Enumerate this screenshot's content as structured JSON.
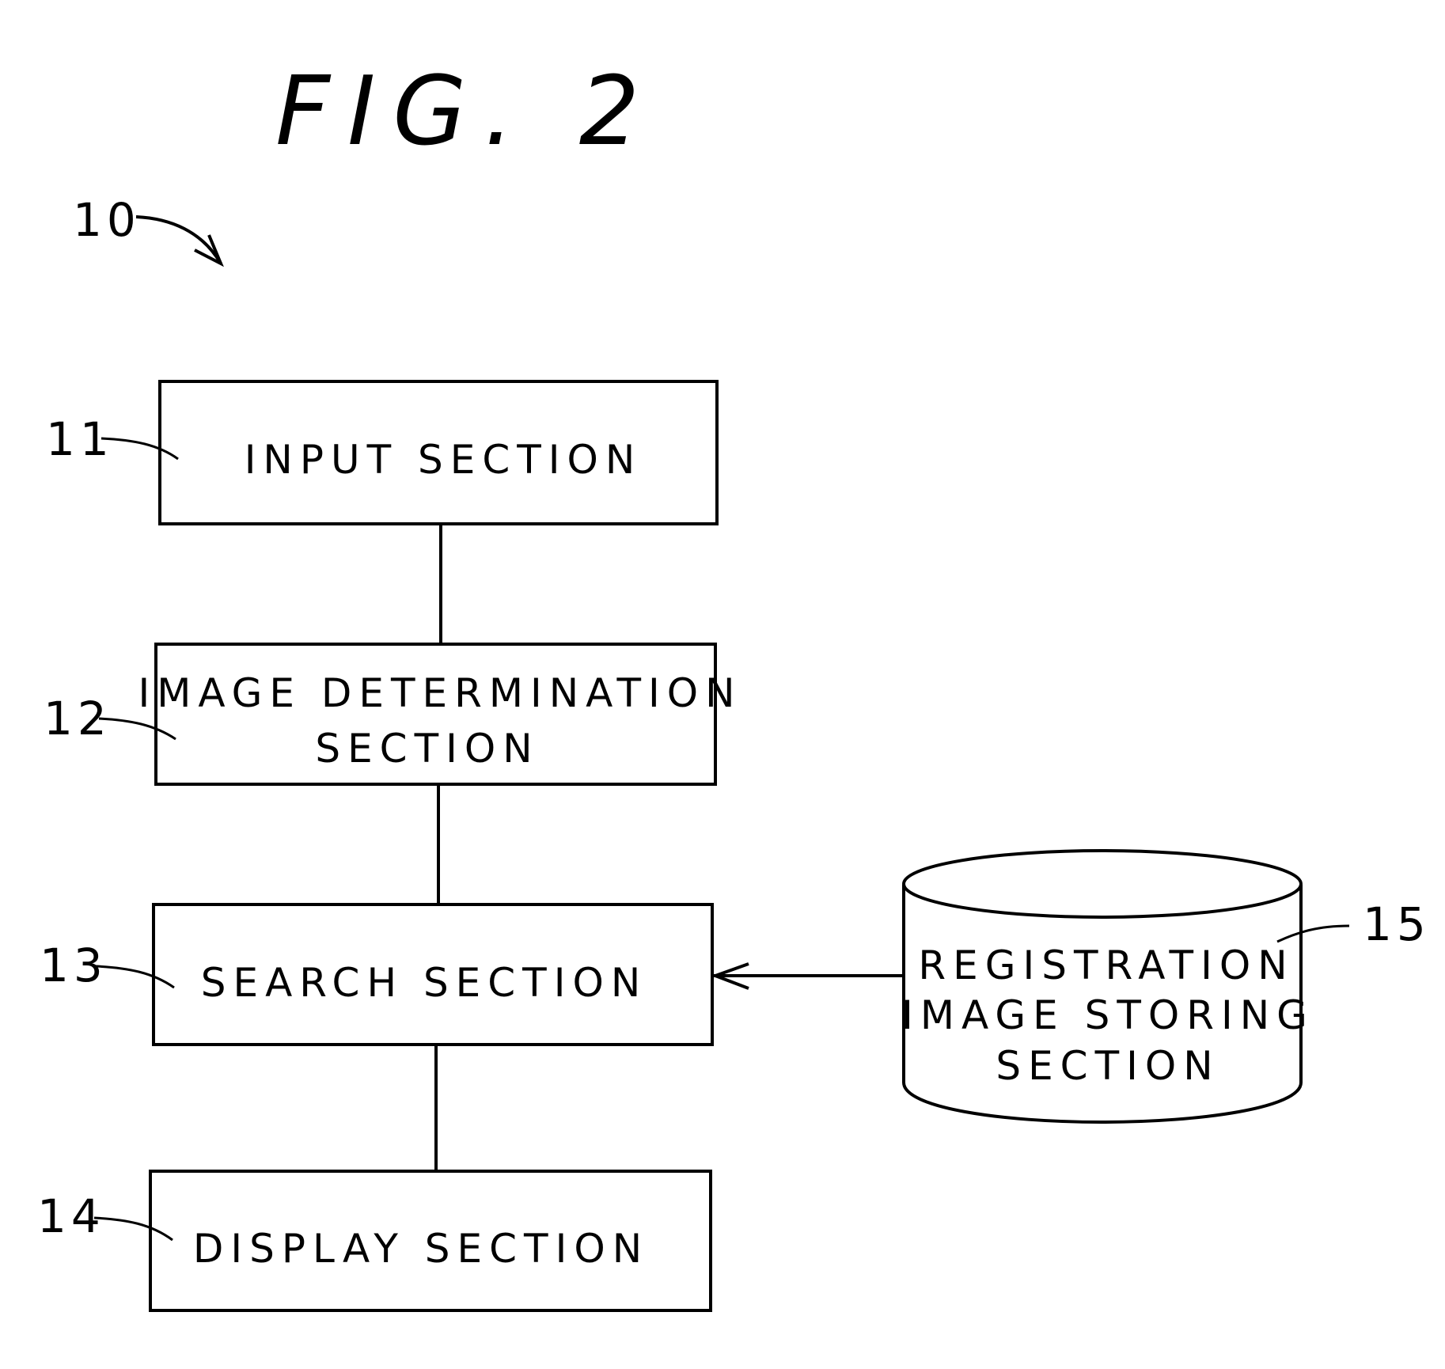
{
  "figure": {
    "title": "FIG. 2",
    "system_ref": "10"
  },
  "blocks": [
    {
      "ref": "11",
      "lines": [
        "INPUT SECTION"
      ]
    },
    {
      "ref": "12",
      "lines": [
        "IMAGE DETERMINATION",
        "SECTION"
      ]
    },
    {
      "ref": "13",
      "lines": [
        "SEARCH SECTION"
      ]
    },
    {
      "ref": "14",
      "lines": [
        "DISPLAY SECTION"
      ]
    }
  ],
  "storage": {
    "ref": "15",
    "lines": [
      "REGISTRATION",
      "IMAGE STORING",
      "SECTION"
    ]
  },
  "connections": [
    {
      "from": "11",
      "to": "12",
      "type": "line"
    },
    {
      "from": "12",
      "to": "13",
      "type": "line"
    },
    {
      "from": "13",
      "to": "14",
      "type": "line"
    },
    {
      "from": "15",
      "to": "13",
      "type": "arrow"
    }
  ]
}
